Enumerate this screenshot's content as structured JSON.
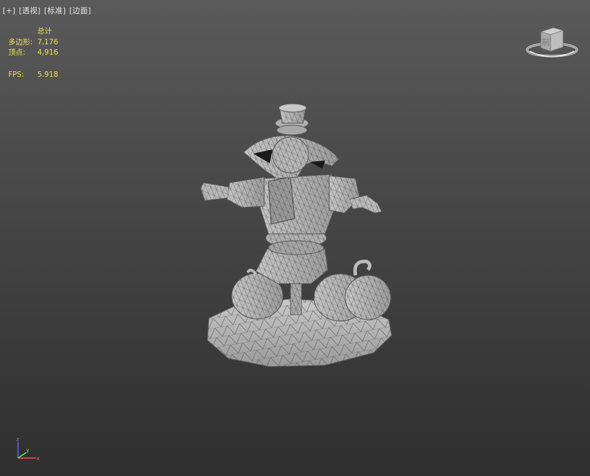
{
  "viewport": {
    "labels": [
      "[+]",
      "[透视]",
      "[标准]",
      "[边面]"
    ]
  },
  "stats": {
    "header": "总计",
    "polygons_label": "多边形:",
    "polygons_value": "7,176",
    "vertices_label": "顶点:",
    "vertices_value": "4,916",
    "fps_label": "FPS:",
    "fps_value": "5.918"
  },
  "viewcube": {
    "face_label": "前"
  },
  "axis_tripod": {
    "axes": [
      "z",
      "x",
      "y"
    ]
  },
  "colors": {
    "stats_text": "#f0e05a",
    "label_text": "#e6e6e6",
    "mesh_fill": "#b4b4b4",
    "wire": "#444444"
  }
}
